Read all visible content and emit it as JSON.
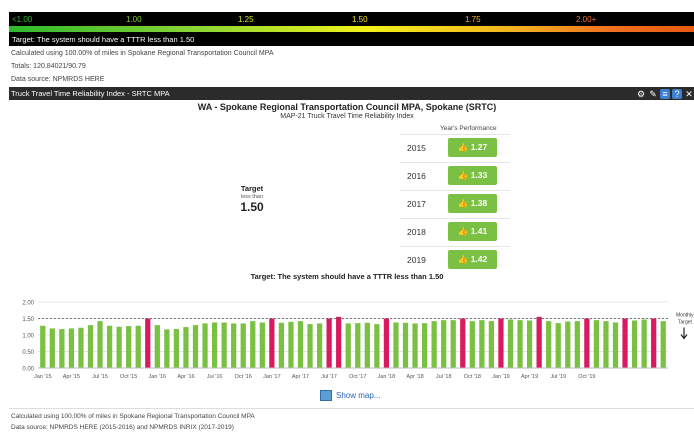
{
  "legend": {
    "labels": [
      "<1.00",
      "1.00",
      "1.25",
      "1.50",
      "1.75",
      "2.00+"
    ],
    "label_colors": [
      "#2eb82e",
      "#7fd02e",
      "#d9e61c",
      "#f2e51a",
      "#f4b120",
      "#f07020"
    ]
  },
  "top": {
    "target_text": "Target: The system should have a TTTR less than 1.50",
    "calculated_text": "Calculated using 100.00% of miles in Spokane Regional Transportation Council MPA",
    "totals_text": "Totals: 120.84021/90.79",
    "source_text": "Data source: NPMRDS HERE"
  },
  "panel": {
    "header_title": "Truck Travel Time Reliability Index - SRTC MPA",
    "icons": [
      "gear-icon",
      "pencil-icon",
      "document-icon",
      "help-icon",
      "close-icon"
    ],
    "title": "WA - Spokane Regional Transportation Council MPA, Spokane (SRTC)",
    "subtitle": "MAP-21 Truck Travel Time Reliability Index",
    "perf_header": "Year's Performance",
    "years": [
      {
        "year": "2015",
        "value": "1.27"
      },
      {
        "year": "2016",
        "value": "1.33"
      },
      {
        "year": "2017",
        "value": "1.38"
      },
      {
        "year": "2018",
        "value": "1.41"
      },
      {
        "year": "2019",
        "value": "1.42"
      }
    ],
    "target_label": "Target",
    "target_qualifier": "less than",
    "target_value": "1.50",
    "chart_target_text": "Target: The system should have a TTTR less than 1.50",
    "show_map": "Show map...",
    "footer_calculated": "Calculated using 100.00% of miles in Spokane Regional Transportation Council MPA",
    "footer_source": "Data source: NPMRDS HERE (2015-2016) and NPMRDS INRIX (2017-2019)",
    "colors": {
      "good": "#7ac143",
      "bad": "#d81b60"
    }
  },
  "chart_data": {
    "type": "bar",
    "ylim": [
      0,
      2.0
    ],
    "yticks": [
      "2.00",
      "1.50",
      "1.00",
      "0.50",
      "0.00"
    ],
    "target_line": 1.5,
    "target_label": "Monthly Target",
    "x_tick_labels": [
      "Jan '15",
      "Apr '15",
      "Jul '15",
      "Oct '15",
      "Jan '16",
      "Apr '16",
      "Jul '16",
      "Oct '16",
      "Jan '17",
      "Apr '17",
      "Jul '17",
      "Oct '17",
      "Jan '18",
      "Apr '18",
      "Jul '18",
      "Oct '18",
      "Jan '19",
      "Apr '19",
      "Jul '19",
      "Oct '19"
    ],
    "values": [
      1.28,
      1.2,
      1.18,
      1.2,
      1.22,
      1.3,
      1.42,
      1.28,
      1.25,
      1.27,
      1.28,
      1.5,
      1.3,
      1.17,
      1.18,
      1.24,
      1.3,
      1.35,
      1.38,
      1.38,
      1.35,
      1.35,
      1.42,
      1.38,
      1.5,
      1.37,
      1.4,
      1.42,
      1.33,
      1.35,
      1.5,
      1.55,
      1.35,
      1.36,
      1.37,
      1.33,
      1.5,
      1.38,
      1.37,
      1.35,
      1.36,
      1.42,
      1.45,
      1.45,
      1.5,
      1.42,
      1.45,
      1.42,
      1.5,
      1.47,
      1.45,
      1.44,
      1.55,
      1.42,
      1.36,
      1.41,
      1.42,
      1.5,
      1.45,
      1.42,
      1.38,
      1.5,
      1.44,
      1.47,
      1.5,
      1.42
    ]
  }
}
